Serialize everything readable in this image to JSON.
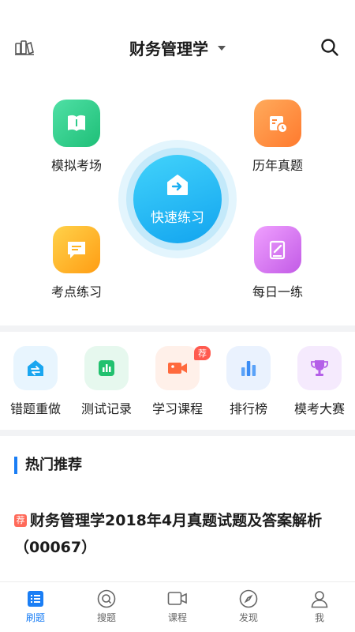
{
  "header": {
    "title": "财务管理学",
    "left_icon": "book-shelf-icon",
    "right_icon": "search-icon"
  },
  "hero": {
    "items": [
      {
        "label": "模拟考场",
        "icon": "book-icon",
        "color": "#2ecb8a"
      },
      {
        "label": "历年真题",
        "icon": "calendar-clock-icon",
        "color": "#ff8a3d"
      },
      {
        "label": "考点练习",
        "icon": "message-note-icon",
        "color": "#ffb320"
      },
      {
        "label": "每日一练",
        "icon": "notebook-pen-icon",
        "color": "#d675f0"
      }
    ],
    "quick_practice": {
      "label": "快速练习",
      "icon": "house-arrow-icon",
      "color": "#1aaef2"
    }
  },
  "tools": [
    {
      "label": "错题重做",
      "icon": "swap-icon",
      "color": "#1aa6f0"
    },
    {
      "label": "测试记录",
      "icon": "bar-chart-icon",
      "color": "#22c16f"
    },
    {
      "label": "学习课程",
      "icon": "video-camera-icon",
      "color": "#ff6a3d",
      "badge": "荐"
    },
    {
      "label": "排行榜",
      "icon": "ranking-icon",
      "color": "#3a8cf5"
    },
    {
      "label": "模考大赛",
      "icon": "trophy-icon",
      "color": "#b45fe8"
    }
  ],
  "hot": {
    "section_title": "热门推荐",
    "article": {
      "tag": "荐",
      "title": "财务管理学2018年4月真题试题及答案解析（00067）"
    }
  },
  "nav": {
    "items": [
      {
        "label": "刷题",
        "icon": "list-icon",
        "active": true
      },
      {
        "label": "搜题",
        "icon": "search-circle-icon"
      },
      {
        "label": "课程",
        "icon": "video-icon"
      },
      {
        "label": "发现",
        "icon": "compass-icon"
      },
      {
        "label": "我",
        "icon": "user-icon"
      }
    ],
    "active_color": "#1a7ef5"
  }
}
